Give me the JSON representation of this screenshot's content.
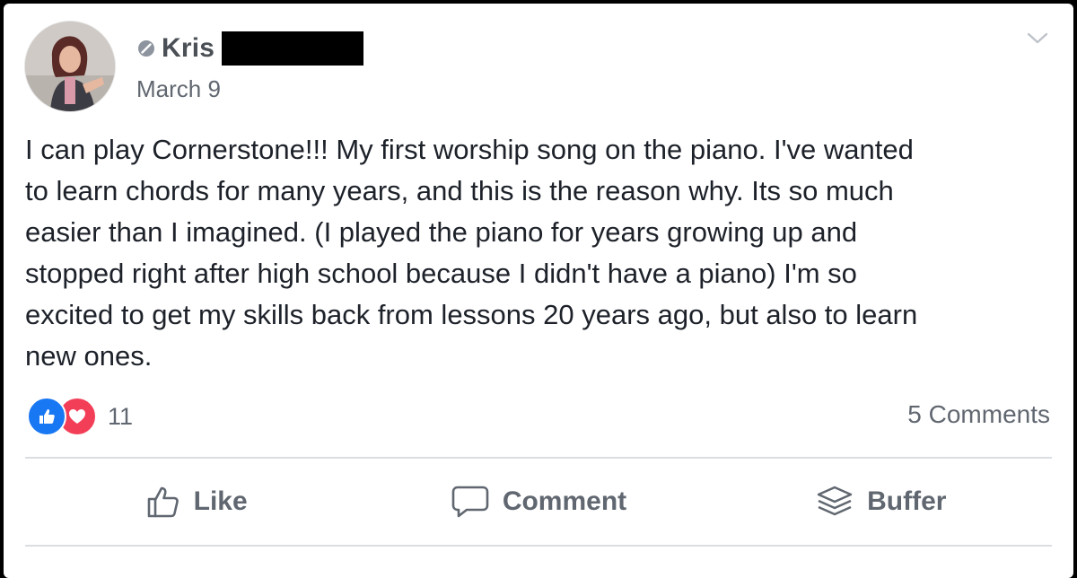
{
  "post": {
    "author": "Kris",
    "date": "March 9",
    "text": "I can play Cornerstone!!! My first worship song on the piano. I've wanted\nto learn chords for many years, and this is the reason why. Its so much\neasier than I imagined. (I played the piano for years growing up and\nstopped right after high school because I didn't have a piano) I'm so\nexcited to get my skills back from lessons 20 years ago, but also to learn\nnew ones."
  },
  "reactions": {
    "types": [
      "like-icon",
      "love-icon"
    ],
    "count": "11"
  },
  "comments": {
    "label": "5 Comments"
  },
  "actions": {
    "like": "Like",
    "comment": "Comment",
    "buffer": "Buffer"
  },
  "colors": {
    "like_blue": "#1877f2",
    "love_red": "#f33e58",
    "text_dark": "#1d2129",
    "text_muted": "#616770"
  }
}
